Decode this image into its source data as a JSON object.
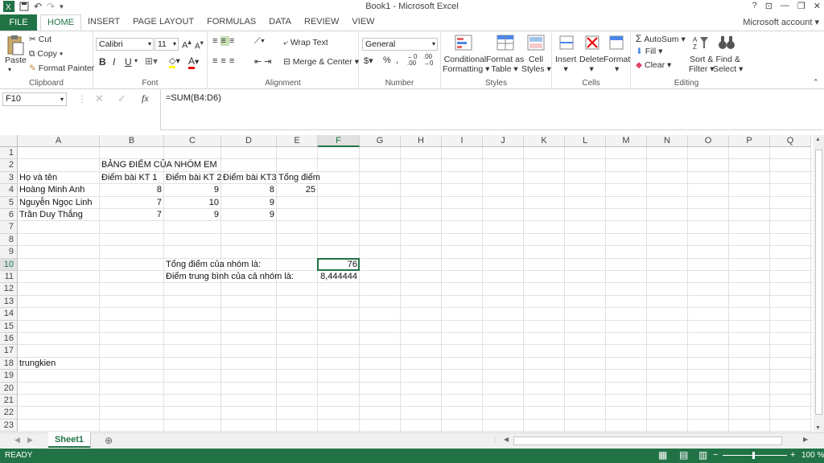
{
  "window": {
    "title": "Book1 - Microsoft Excel"
  },
  "tabs": {
    "file": "FILE",
    "items": [
      "HOME",
      "INSERT",
      "PAGE LAYOUT",
      "FORMULAS",
      "DATA",
      "REVIEW",
      "VIEW"
    ],
    "account": "Microsoft account"
  },
  "ribbon": {
    "clipboard": {
      "label": "Clipboard",
      "paste": "Paste",
      "cut": "Cut",
      "copy": "Copy",
      "format_painter": "Format Painter"
    },
    "font": {
      "label": "Font",
      "name": "Calibri",
      "size": "11"
    },
    "alignment": {
      "label": "Alignment",
      "wrap": "Wrap Text",
      "merge": "Merge & Center"
    },
    "number": {
      "label": "Number",
      "format": "General"
    },
    "styles": {
      "label": "Styles",
      "conditional1": "Conditional",
      "conditional2": "Formatting",
      "format_as1": "Format as",
      "format_as2": "Table",
      "cell1": "Cell",
      "cell2": "Styles"
    },
    "cells": {
      "label": "Cells",
      "insert": "Insert",
      "delete": "Delete",
      "format": "Format"
    },
    "editing": {
      "label": "Editing",
      "autosum": "AutoSum",
      "fill": "Fill",
      "clear": "Clear",
      "sort1": "Sort &",
      "sort2": "Filter",
      "find1": "Find &",
      "find2": "Select"
    }
  },
  "formula_bar": {
    "name_box": "F10",
    "formula": "=SUM(B4:D6)"
  },
  "sheet": {
    "columns": [
      "A",
      "B",
      "C",
      "D",
      "E",
      "F",
      "G",
      "H",
      "I",
      "J",
      "K",
      "L",
      "M",
      "N",
      "O",
      "P",
      "Q"
    ],
    "rows": [
      "1",
      "2",
      "3",
      "4",
      "5",
      "6",
      "7",
      "8",
      "9",
      "10",
      "11",
      "12",
      "13",
      "14",
      "15",
      "16",
      "17",
      "18",
      "19",
      "20",
      "21",
      "22",
      "23"
    ],
    "cells": {
      "B2": "BẢNG ĐIỂM CỦA NHÓM EM",
      "A3": "Họ và tên",
      "B3": "Điểm bài KT 1",
      "C3": "Điểm bài KT 2",
      "D3": "Điểm bài KT3",
      "E3": "Tổng điểm",
      "A4": "Hoàng Minh Anh",
      "B4": "8",
      "C4": "9",
      "D4": "8",
      "E4": "25",
      "A5": "Nguyễn Ngọc Linh",
      "B5": "7",
      "C5": "10",
      "D5": "9",
      "A6": "Trần Duy Thắng",
      "B6": "7",
      "C6": "9",
      "D6": "9",
      "C10": "Tổng điểm của nhóm là:",
      "F10": "76",
      "C11": "Điểm trung bình của cả nhóm là:",
      "F11": "8,444444",
      "A18": "trungkien"
    },
    "active_cell": "F10",
    "sheet_tab": "Sheet1"
  },
  "status": {
    "ready": "READY",
    "zoom": "100 %"
  }
}
